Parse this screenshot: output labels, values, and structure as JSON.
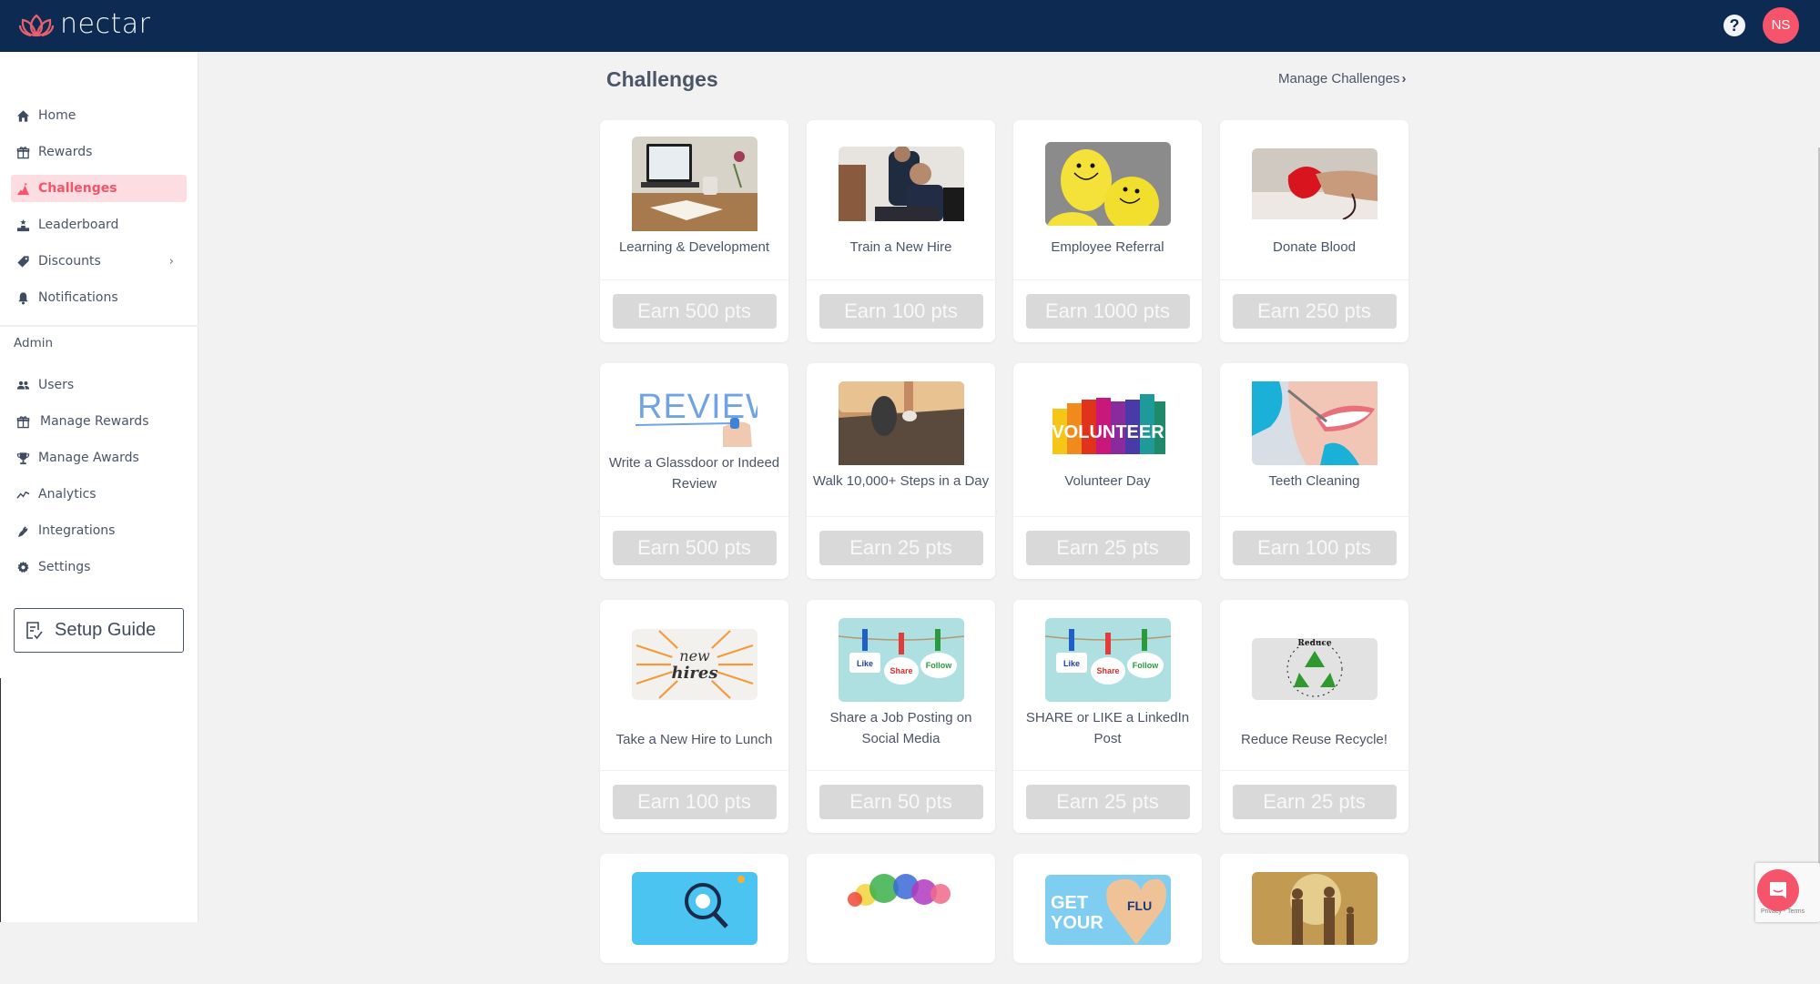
{
  "app": {
    "brand": "nectar",
    "brand_color": "#f5546a",
    "topbar_color": "#0d2b52",
    "help_icon": "question-circle-icon",
    "user_initials": "NS"
  },
  "sidebar": {
    "items": [
      {
        "label": "Home",
        "icon": "home-icon",
        "active": false
      },
      {
        "label": "Rewards",
        "icon": "gift-icon",
        "active": false
      },
      {
        "label": "Challenges",
        "icon": "mountain-flag-icon",
        "active": true
      },
      {
        "label": "Leaderboard",
        "icon": "podium-icon",
        "active": false
      },
      {
        "label": "Discounts",
        "icon": "tag-icon",
        "active": false,
        "has_submenu": true,
        "chevron": "›"
      },
      {
        "label": "Notifications",
        "icon": "bell-icon",
        "active": false
      }
    ],
    "admin_label": "Admin",
    "admin_items": [
      {
        "label": "Users",
        "icon": "users-icon"
      },
      {
        "label": "Manage Rewards",
        "icon": "gift-icon"
      },
      {
        "label": "Manage Awards",
        "icon": "trophy-icon"
      },
      {
        "label": "Analytics",
        "icon": "chart-line-icon"
      },
      {
        "label": "Integrations",
        "icon": "plug-icon"
      },
      {
        "label": "Settings",
        "icon": "gear-icon"
      }
    ],
    "setup_guide_label": "Setup Guide"
  },
  "main": {
    "title": "Challenges",
    "manage_link": "Manage Challenges",
    "manage_chevron": "›",
    "cards": [
      {
        "title": "Learning & Development",
        "earn": "Earn 500 pts",
        "image": "laptop-desk-photo"
      },
      {
        "title": "Train a New Hire",
        "earn": "Earn 100 pts",
        "image": "coworkers-training-photo"
      },
      {
        "title": "Employee Referral",
        "earn": "Earn 1000 pts",
        "image": "smiley-balloons-photo"
      },
      {
        "title": "Donate Blood",
        "earn": "Earn 250 pts",
        "image": "blood-donation-photo"
      },
      {
        "title": "Write a Glassdoor or Indeed Review",
        "earn": "Earn 500 pts",
        "image": "review-handwriting-image",
        "image_text": "REVIEW"
      },
      {
        "title": "Walk 10,000+ Steps in a Day",
        "earn": "Earn 25 pts",
        "image": "running-shoes-road-photo"
      },
      {
        "title": "Volunteer Day",
        "earn": "Earn 25 pts",
        "image": "volunteer-hands-image",
        "image_text": "VOLUNTEER"
      },
      {
        "title": "Teeth Cleaning",
        "earn": "Earn 100 pts",
        "image": "dental-cleaning-photo"
      },
      {
        "title": "Take a New Hire to Lunch",
        "earn": "Earn 100 pts",
        "image": "new-hires-sunburst-image",
        "image_text": "New hires"
      },
      {
        "title": "Share a Job Posting on Social Media",
        "earn": "Earn 50 pts",
        "image": "like-share-follow-image",
        "image_labels": [
          "Like",
          "Share",
          "Follow"
        ]
      },
      {
        "title": "SHARE or LIKE a LinkedIn Post",
        "earn": "Earn 25 pts",
        "image": "like-share-follow-image",
        "image_labels": [
          "Like",
          "Share",
          "Follow"
        ]
      },
      {
        "title": "Reduce Reuse Recycle!",
        "earn": "Earn 25 pts",
        "image": "recycle-logo-image"
      },
      {
        "title": "",
        "earn": "",
        "image": "data-analysis-gears-image"
      },
      {
        "title": "",
        "earn": "",
        "image": "speech-bubbles-colorful-image"
      },
      {
        "title": "",
        "earn": "",
        "image": "flu-shot-image",
        "image_text": "GET YOUR FLU SHOT"
      },
      {
        "title": "",
        "earn": "",
        "image": "family-silhouette-photo"
      }
    ]
  },
  "overlay": {
    "recaptcha_text": "Privacy - Terms",
    "chat_icon": "chat-bubble-icon"
  }
}
